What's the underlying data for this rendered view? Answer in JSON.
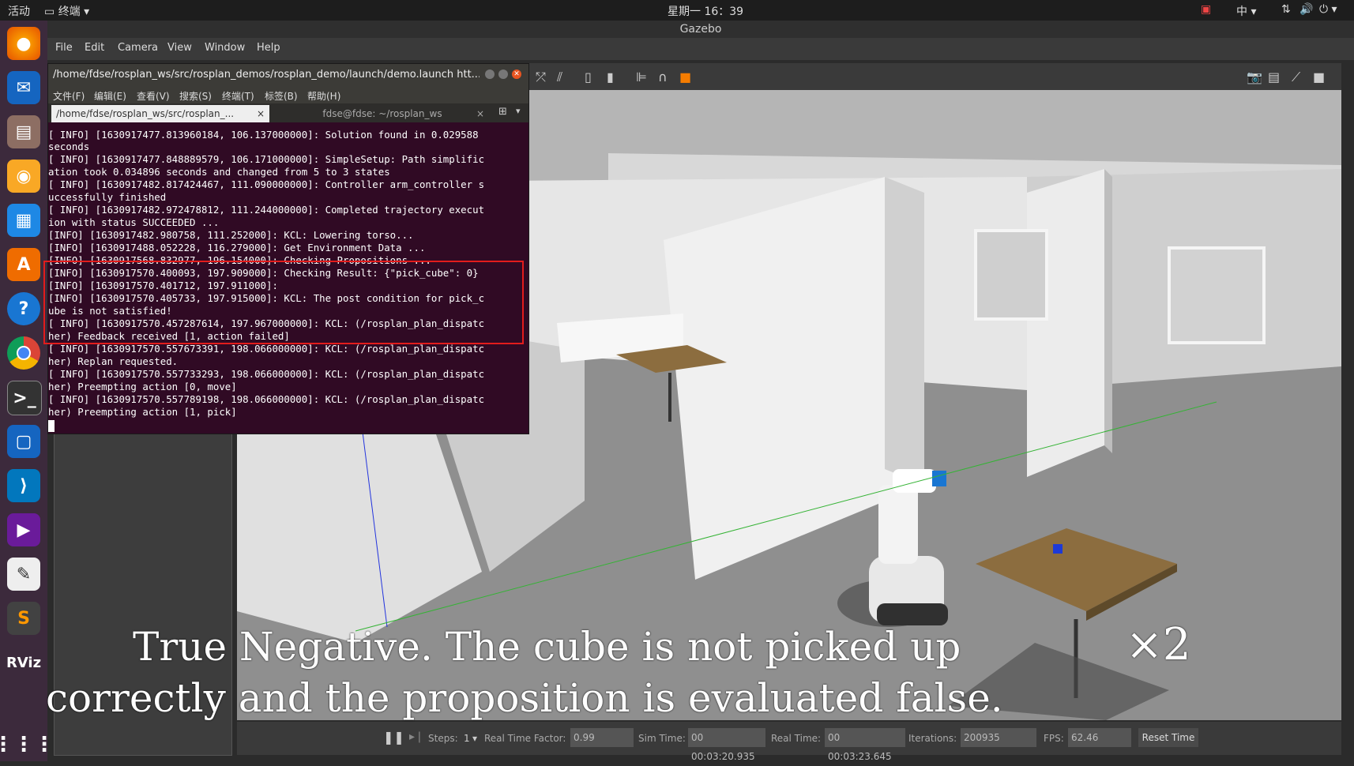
{
  "topbar": {
    "activities": "活动",
    "app": "终端",
    "clock": "星期一 16：39",
    "input": "中"
  },
  "gazebo": {
    "window_title": "Gazebo",
    "menu": [
      "File",
      "Edit",
      "Camera",
      "View",
      "Window",
      "Help"
    ],
    "bottom": {
      "steps_label": "Steps:",
      "steps_value": "1",
      "rtf_label": "Real Time Factor:",
      "rtf_value": "0.99",
      "sim_label": "Sim Time:",
      "sim_value": "00 00:03:20.935",
      "real_label": "Real Time:",
      "real_value": "00 00:03:23.645",
      "iter_label": "Iterations:",
      "iter_value": "200935",
      "fps_label": "FPS:",
      "fps_value": "62.46",
      "reset": "Reset Time"
    }
  },
  "terminal": {
    "title": "/home/fdse/rosplan_ws/src/rosplan_demos/rosplan_demo/launch/demo.launch htt...",
    "menu": [
      "文件(F)",
      "编辑(E)",
      "查看(V)",
      "搜索(S)",
      "终端(T)",
      "标签(B)",
      "帮助(H)"
    ],
    "tabs": [
      "/home/fdse/rosplan_ws/src/rosplan_...",
      "fdse@fdse: ~/rosplan_ws"
    ],
    "lines": [
      "[ INFO] [1630917477.813960184, 106.137000000]: Solution found in 0.029588",
      "seconds",
      "[ INFO] [1630917477.848889579, 106.171000000]: SimpleSetup: Path simplific",
      "ation took 0.034896 seconds and changed from 5 to 3 states",
      "[ INFO] [1630917482.817424467, 111.090000000]: Controller arm_controller s",
      "uccessfully finished",
      "[ INFO] [1630917482.972478812, 111.244000000]: Completed trajectory execut",
      "ion with status SUCCEEDED ...",
      "[INFO] [1630917482.980758, 111.252000]: KCL: Lowering torso...",
      "[INFO] [1630917488.052228, 116.279000]: Get Environment Data ...",
      "[INFO] [1630917568.832977, 196.154000]: Checking Propositions ...",
      "[INFO] [1630917570.400093, 197.909000]: Checking Result: {\"pick_cube\": 0}",
      "[INFO] [1630917570.401712, 197.911000]:",
      "[INFO] [1630917570.405733, 197.915000]: KCL: The post condition for pick_c",
      "ube is not satisfied!",
      "[ INFO] [1630917570.457287614, 197.967000000]: KCL: (/rosplan_plan_dispatc",
      "her) Feedback received [1, action failed]",
      "[ INFO] [1630917570.557673391, 198.066000000]: KCL: (/rosplan_plan_dispatc",
      "her) Replan requested.",
      "[ INFO] [1630917570.557733293, 198.066000000]: KCL: (/rosplan_plan_dispatc",
      "her) Preempting action [0, move]",
      "[ INFO] [1630917570.557789198, 198.066000000]: KCL: (/rosplan_plan_dispatc",
      "her) Preempting action [1, pick]"
    ]
  },
  "caption": {
    "line1": "True Negative. The cube is not picked up",
    "mult": "×2",
    "line2": "correctly and the proposition is evaluated false."
  },
  "dock_icons": [
    "firefox-icon",
    "thunderbird-icon",
    "files-icon",
    "rhythmbox-icon",
    "writer-icon",
    "software-icon",
    "help-icon",
    "chrome-icon",
    "terminal-icon",
    "virtualbox-icon",
    "vscode-icon",
    "video-icon",
    "text-editor-icon",
    "sublime-icon",
    "rviz-icon",
    "apps-grid-icon"
  ]
}
